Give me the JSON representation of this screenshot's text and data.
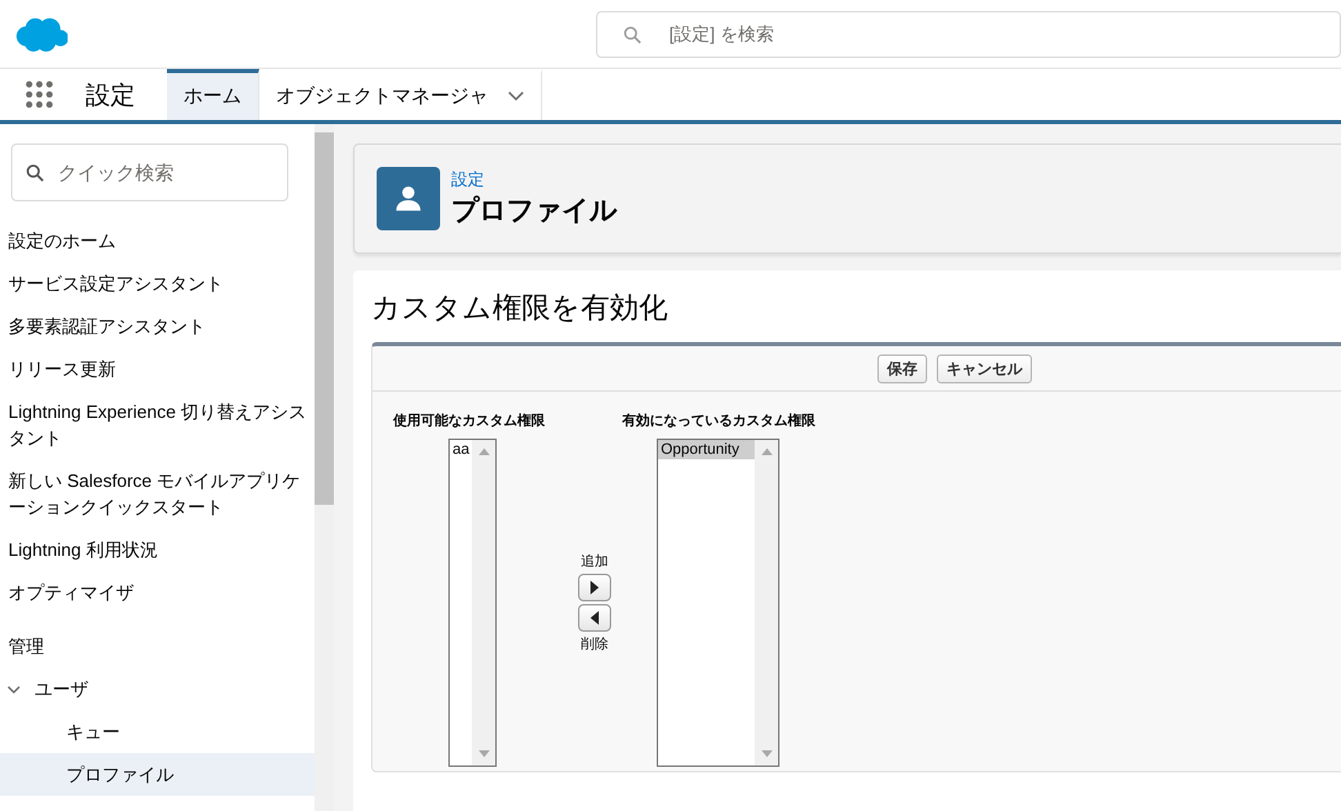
{
  "header": {
    "search": {
      "placeholder": "[設定] を検索"
    }
  },
  "nav": {
    "app_name": "設定",
    "tabs": [
      {
        "label": "ホーム",
        "selected": true,
        "kind": "tab"
      },
      {
        "label": "オブジェクトマネージャ",
        "selected": false,
        "kind": "menu"
      }
    ]
  },
  "sidebar": {
    "search": {
      "placeholder": "クイック検索"
    },
    "items": [
      {
        "label": "設定のホーム",
        "selected": false
      },
      {
        "label": "サービス設定アシスタント",
        "selected": false
      },
      {
        "label": "多要素認証アシスタント",
        "selected": false
      },
      {
        "label": "リリース更新",
        "selected": false
      },
      {
        "label": "Lightning Experience 切り替えアシスタント",
        "selected": false
      },
      {
        "label": "新しい Salesforce モバイルアプリケーションクイックスタート",
        "selected": false
      },
      {
        "label": "Lightning 利用状況",
        "selected": false
      },
      {
        "label": "オプティマイザ",
        "selected": false
      }
    ],
    "sections": [
      {
        "title": "管理",
        "items": [
          {
            "label": "ユーザ",
            "expanded": true,
            "selected": false,
            "children": [
              {
                "label": "キュー",
                "selected": false
              },
              {
                "label": "プロファイル",
                "selected": true
              }
            ]
          }
        ]
      }
    ]
  },
  "page_header": {
    "breadcrumb": "設定",
    "title": "プロファイル"
  },
  "content": {
    "title": "カスタム権限を有効化",
    "buttons": [
      "保存",
      "キャンセル"
    ],
    "available": {
      "label": "使用可能なカスタム権限",
      "options": [
        {
          "label": "aa",
          "selected": false
        }
      ]
    },
    "add_label": "追加",
    "remove_label": "削除",
    "enabled": {
      "label": "有効になっているカスタム権限",
      "options": [
        {
          "label": "Opportunity",
          "selected": true
        }
      ]
    }
  }
}
